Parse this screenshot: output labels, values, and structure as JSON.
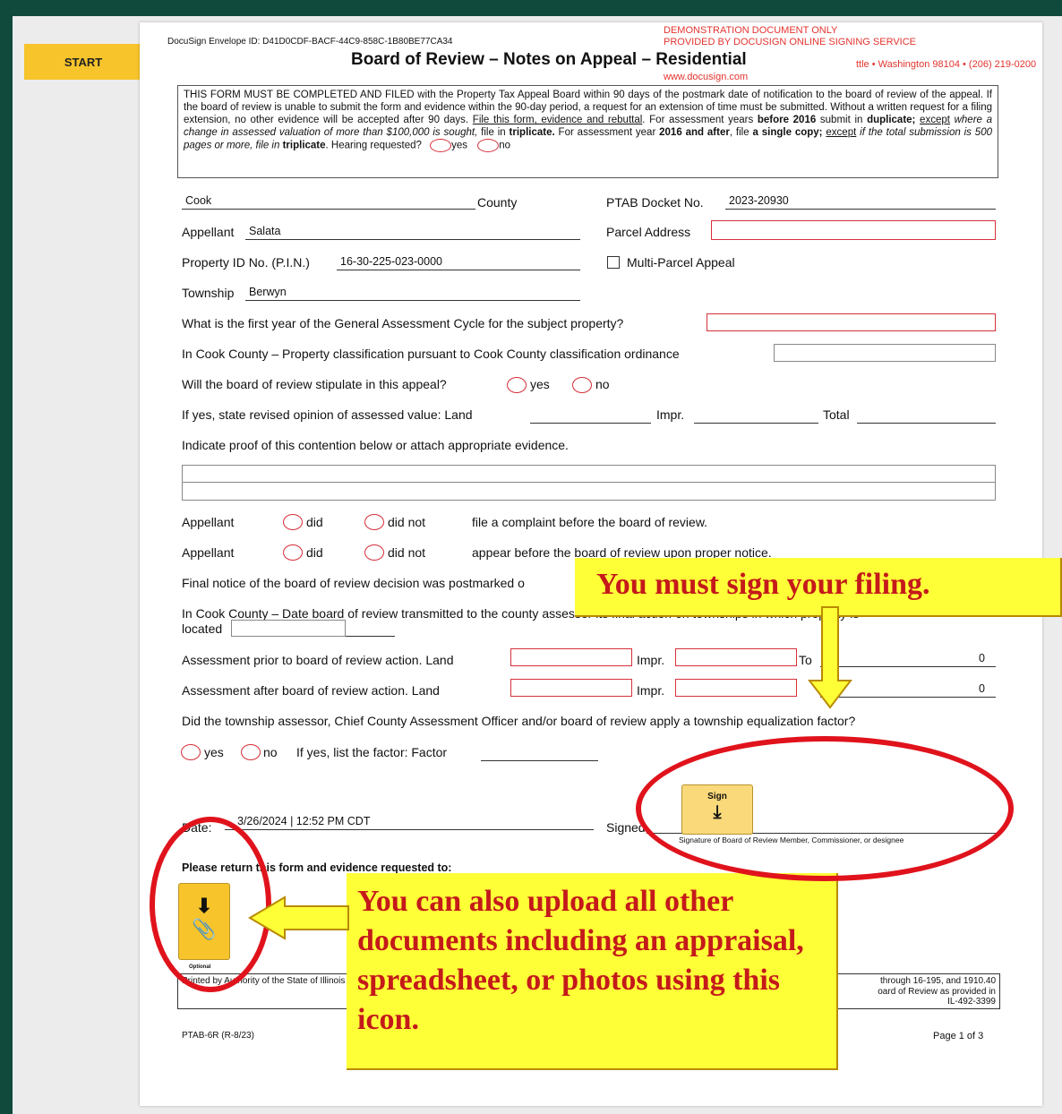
{
  "start_button": "START",
  "envelope_id": "DocuSign Envelope ID: D41D0CDF-BACF-44C9-858C-1B80BE77CA34",
  "demo_notice": [
    "DEMONSTRATION DOCUMENT ONLY",
    "PROVIDED BY DOCUSIGN ONLINE SIGNING SERVICE"
  ],
  "demo_address": "ttle • Washington 98104 • (206) 219-0200",
  "demo_url": "www.docusign.com",
  "form_title": "Board of Review – Notes on Appeal – Residential",
  "notice": {
    "p1": "THIS FORM MUST BE COMPLETED AND FILED with the Property Tax Appeal Board within 90 days of the postmark date of notification to the board of review of the appeal.  If the board of review is unable to submit the form and evidence within the 90-day period, a request for an extension of time must be submitted.  Without a written request for a filing extension, no other evidence will be accepted after 90 days. ",
    "p2_underlined": "File this form, evidence and rebuttal",
    "p2_a": ".  For assessment years ",
    "p2_b_bold": "before 2016",
    "p2_c": " submit in ",
    "p2_d_bold": "duplicate;",
    "p2_e_underlined": "except",
    "p2_f_italic": " where a change in assessed valuation of more than $100,000 is sought,",
    "p2_g": " file in ",
    "p2_h_bold": "triplicate.",
    "p2_i": "  For assessment year ",
    "p2_j_bold": "2016 and after",
    "p2_k": ", file ",
    "p2_l_bold": "a single copy;",
    "p2_m_underlined": "except",
    "p2_n_italic": " if the total submission is 500 pages or more, file in ",
    "p2_o_bold": "triplicate",
    "p2_p": ".  Hearing requested?",
    "yes": "yes",
    "no": "no"
  },
  "fields": {
    "county_value": "Cook",
    "county_label": "County",
    "docket_label": "PTAB Docket No.",
    "docket_value": "2023-20930",
    "appellant_label": "Appellant",
    "appellant_value": "Salata",
    "parcel_label": "Parcel Address",
    "pin_label": "Property ID No. (P.I.N.)",
    "pin_value": "16-30-225-023-0000",
    "multi_parcel_label": "Multi-Parcel Appeal",
    "township_label": "Township",
    "township_value": "Berwyn",
    "first_year_label": "What is the first year of the General Assessment Cycle for the subject property?",
    "classification_label": "In Cook County – Property classification pursuant to Cook County classification ordinance",
    "stipulate_label": "Will the board of review stipulate in this appeal?",
    "yes": "yes",
    "no": "no",
    "revised_label": "If yes, state revised opinion of assessed value:  Land",
    "impr_label": "Impr.",
    "total_label": "Total",
    "proof_label": "Indicate proof of this contention below or attach appropriate evidence.",
    "appellant_word": "Appellant",
    "did": "did",
    "did_not": "did not",
    "complaint_text": "file a complaint before the board of review.",
    "appear_text": "appear before the board of review upon proper notice.",
    "final_notice_label": "Final notice of the board of review decision was postmarked o",
    "transmitted_label": "In Cook County – Date board of review transmitted to the county assessor its final action on townships in which property is",
    "located_label": "located",
    "prior_label": "Assessment prior to board of review action.   Land",
    "after_label": "Assessment after board of review action.      Land",
    "total_short": "To",
    "prior_total": "0",
    "after_total": "0",
    "equalization_label": "Did the township assessor, Chief County Assessment Officer and/or board of review apply a township equalization factor?",
    "factor_label": "If yes, list the factor:  Factor",
    "date_label": "Date:",
    "date_value": "3/26/2024 | 12:52 PM CDT",
    "signed_label": "Signed",
    "signature_caption": "Signature of Board of Review Member, Commissioner, or designee",
    "return_label": "Please return this form and evidence requested to:"
  },
  "sign_tag": "Sign",
  "attach_optional": "Optional",
  "printed_text": "Printed by Authority of the State of Illinois ... of the rules of the Property Tax ... 1910.69 of the rules of the Property Tax",
  "printed_right": [
    "through 16-195, and 1910.40",
    "oard of Review as provided in",
    "IL-492-3399"
  ],
  "form_number": "PTAB-6R (R-8/23)",
  "page_number": "Page 1 of 3",
  "callouts": {
    "sign": "You must sign your filing.",
    "upload": "You can also upload all other documents including an appraisal, spreadsheet, or photos using this icon."
  },
  "colors": {
    "start": "#f7c42b",
    "callout_bg": "#ffff38",
    "callout_text": "#c41a1a",
    "ellipse": "#e0131c",
    "background": "#0f4a3c"
  }
}
